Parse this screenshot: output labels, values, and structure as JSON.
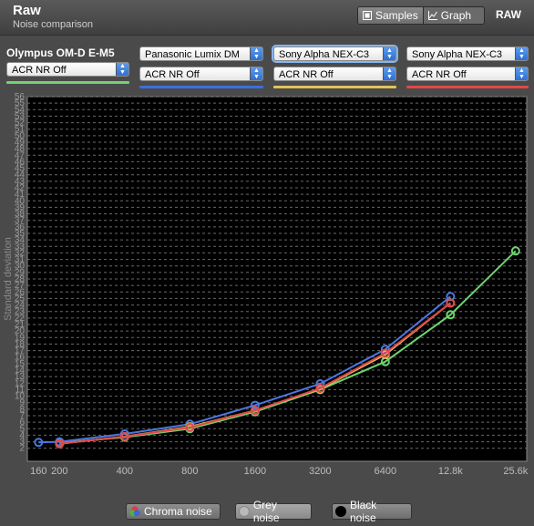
{
  "header": {
    "title": "Raw",
    "subtitle": "Noise comparison",
    "view_toggle": {
      "samples_label": "Samples",
      "graph_label": "Graph",
      "selected": "Samples"
    },
    "mode_badge": "RAW"
  },
  "cameras": [
    {
      "name": "Olympus OM-D E-M5",
      "nr": "ACR NR Off",
      "underline_color": "#6fd36f"
    },
    {
      "name": "Panasonic Lumix DM",
      "nr": "ACR NR Off",
      "underline_color": "#3b6fe0"
    },
    {
      "name": "Sony Alpha NEX-C3",
      "nr": "ACR NR Off",
      "underline_color": "#e3c35a"
    },
    {
      "name": "Sony Alpha NEX-C3",
      "nr": "ACR NR Off",
      "underline_color": "#e04848"
    }
  ],
  "legend": {
    "chroma": "Chroma noise",
    "grey": "Grey noise",
    "black": "Black noise"
  },
  "chart_data": {
    "type": "line",
    "ylabel": "Standard deviation",
    "xlabel": "",
    "categories": [
      "160",
      "200",
      "400",
      "800",
      "1600",
      "3200",
      "6400",
      "12.8k",
      "25.6k"
    ],
    "x_iso": [
      160,
      200,
      400,
      800,
      1600,
      3200,
      6400,
      12800,
      25600
    ],
    "x_scale": "log",
    "ylim": [
      0,
      56
    ],
    "y_ticks": [
      2,
      3,
      4,
      5,
      6,
      7,
      8,
      9,
      10,
      11,
      12,
      13,
      14,
      15,
      16,
      17,
      18,
      19,
      20,
      21,
      22,
      23,
      24,
      25,
      26,
      27,
      28,
      29,
      30,
      31,
      32,
      33,
      34,
      35,
      36,
      37,
      38,
      39,
      40,
      41,
      42,
      43,
      44,
      45,
      46,
      47,
      48,
      49,
      50,
      51,
      52,
      53,
      54,
      55,
      56
    ],
    "grid": true,
    "series": [
      {
        "color": "#6fd36f",
        "points": [
          [
            200,
            2.8
          ],
          [
            400,
            3.7
          ],
          [
            800,
            5.0
          ],
          [
            1600,
            7.6
          ],
          [
            3200,
            11.0
          ],
          [
            6400,
            15.3
          ],
          [
            12800,
            22.5
          ],
          [
            25600,
            32.3
          ]
        ]
      },
      {
        "color": "#4a78e0",
        "points": [
          [
            160,
            2.9
          ],
          [
            200,
            3.0
          ],
          [
            400,
            4.2
          ],
          [
            800,
            5.7
          ],
          [
            1600,
            8.6
          ],
          [
            3200,
            11.9
          ],
          [
            6400,
            17.2
          ],
          [
            12800,
            25.3
          ]
        ]
      },
      {
        "color": "#e3c35a",
        "points": [
          [
            200,
            2.7
          ],
          [
            400,
            3.8
          ],
          [
            800,
            5.3
          ],
          [
            1600,
            7.8
          ],
          [
            3200,
            11.1
          ],
          [
            6400,
            16.4
          ],
          [
            12800,
            24.3
          ]
        ]
      },
      {
        "color": "#e04848",
        "points": [
          [
            200,
            2.7
          ],
          [
            400,
            3.8
          ],
          [
            800,
            5.2
          ],
          [
            1600,
            7.8
          ],
          [
            3200,
            11.2
          ],
          [
            6400,
            16.6
          ],
          [
            12800,
            24.3
          ]
        ]
      }
    ]
  }
}
